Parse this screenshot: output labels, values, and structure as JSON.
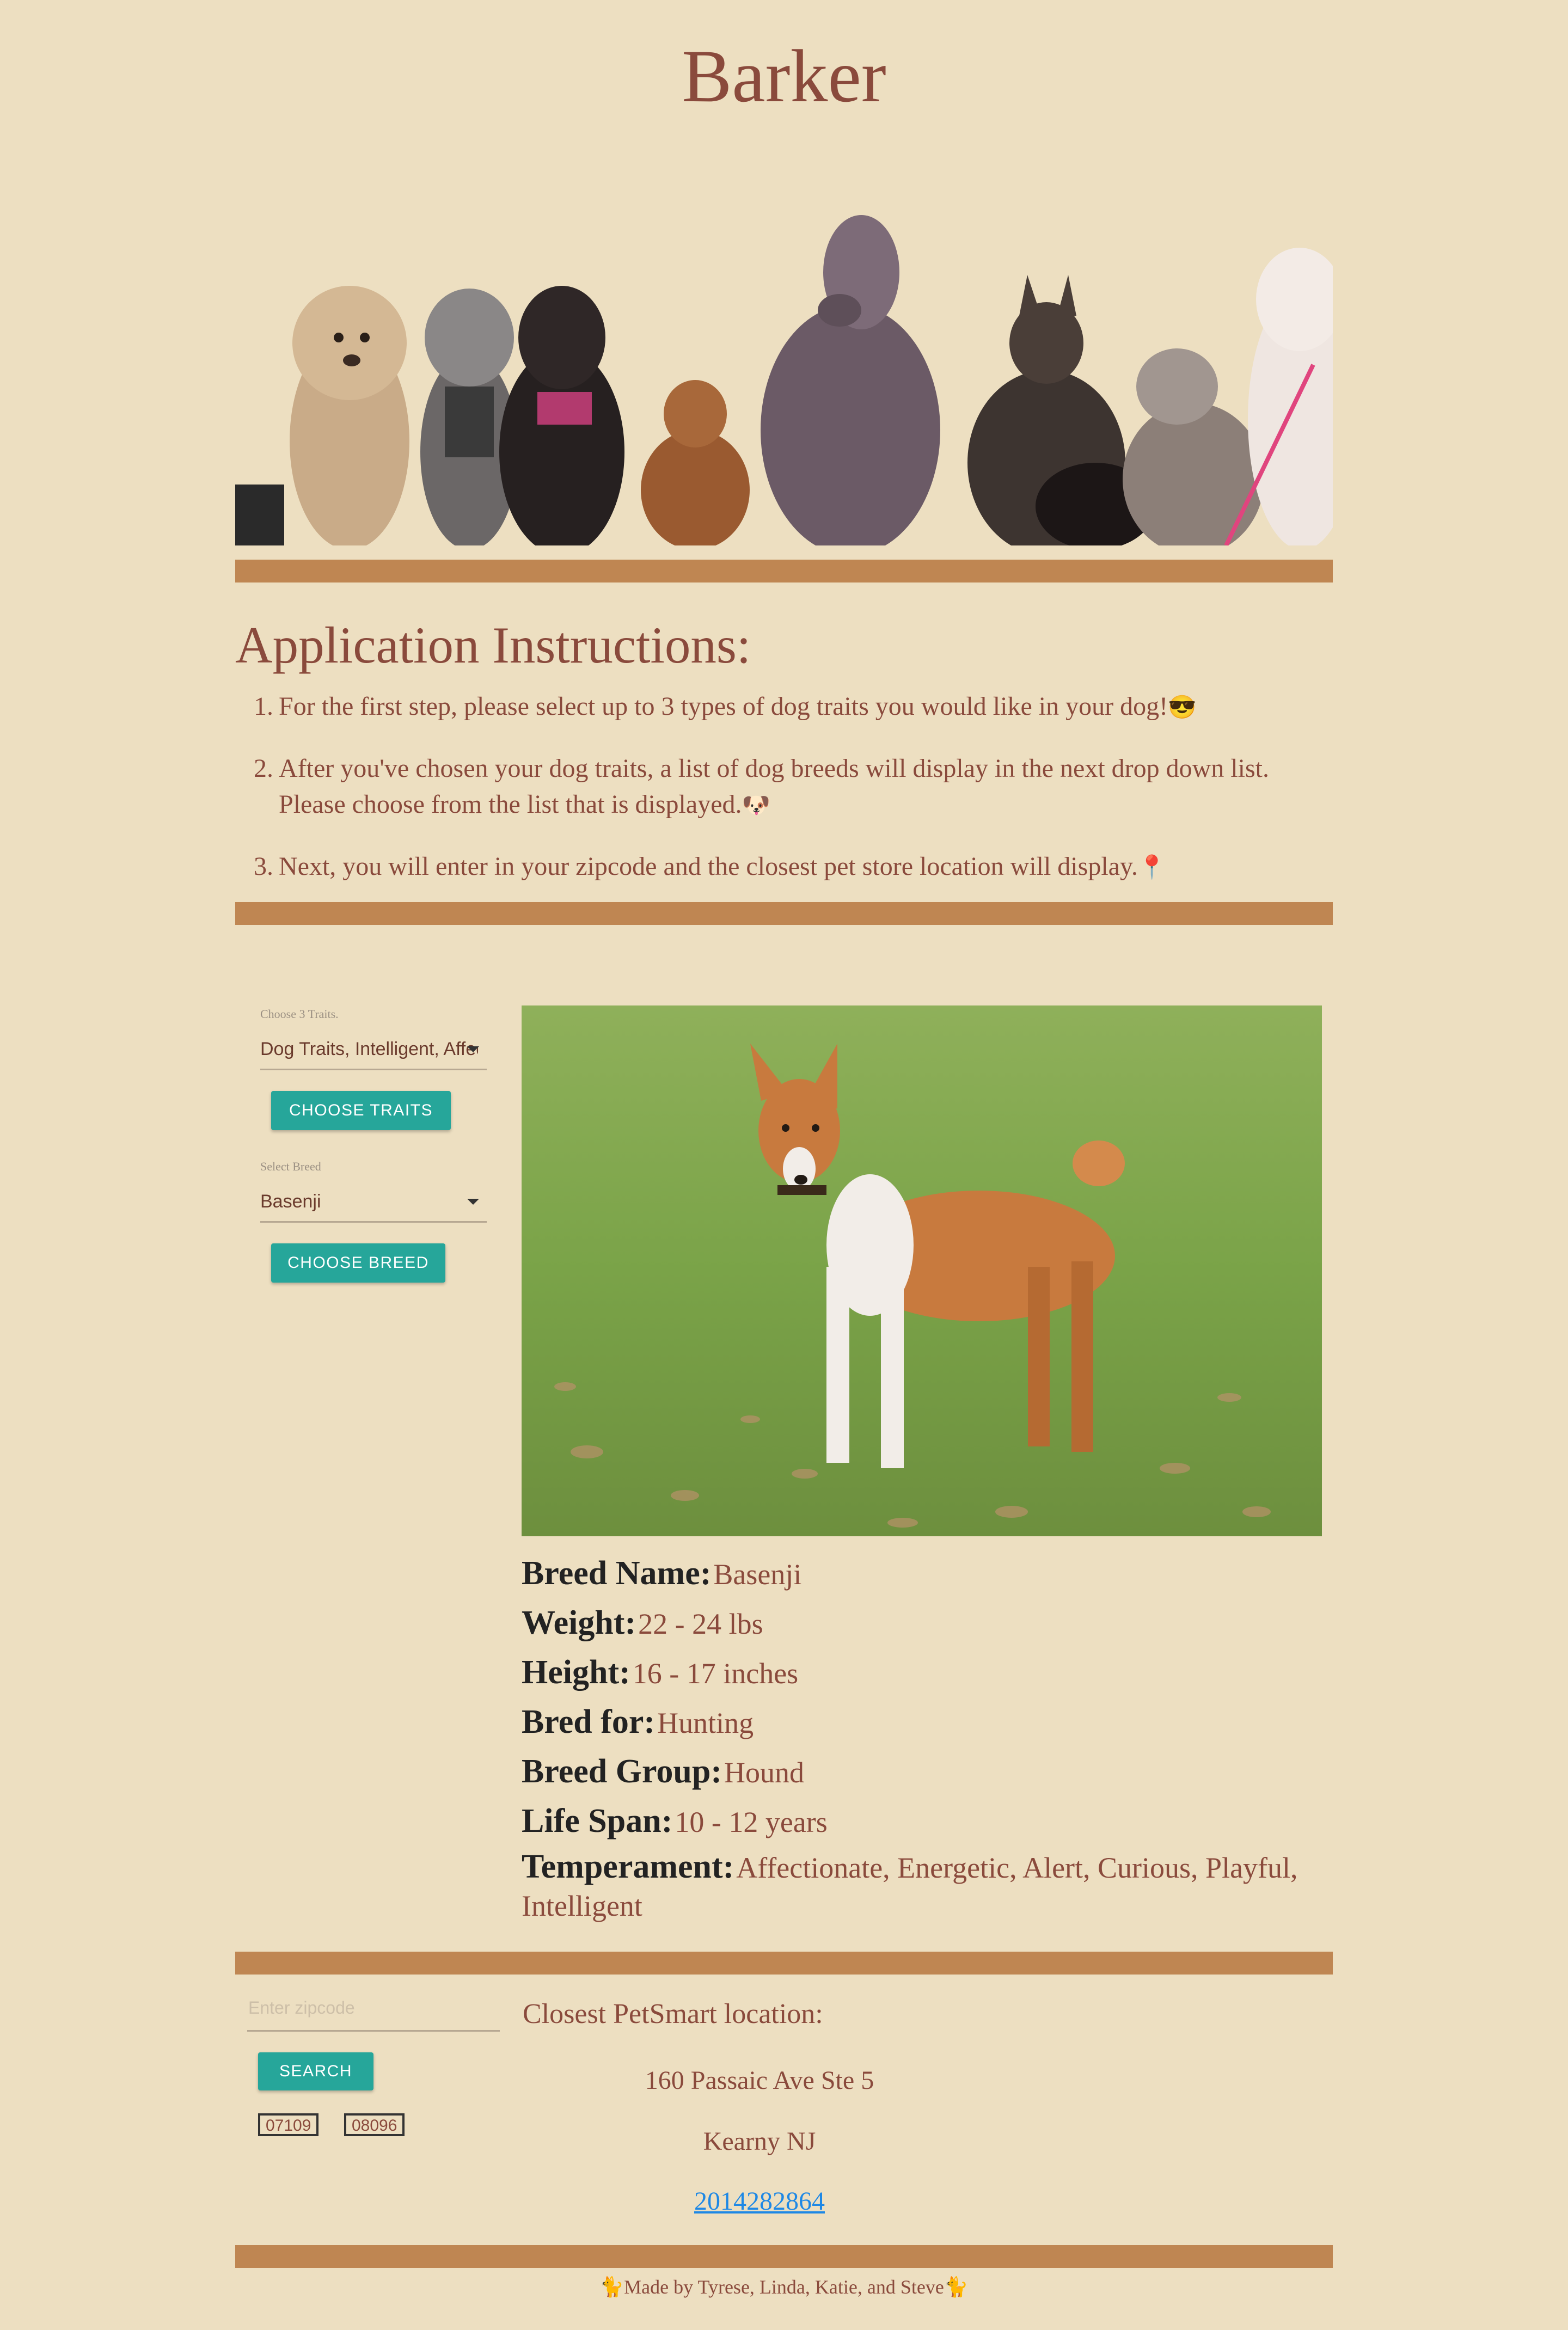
{
  "header": {
    "title": "Barker"
  },
  "instructions": {
    "heading": "Application Instructions:",
    "steps": [
      {
        "num": "1.",
        "text": "For the first step, please select up to 3 types of dog traits you would like in your dog!",
        "emoji": "😎"
      },
      {
        "num": "2.",
        "text": "After you've chosen your dog traits, a list of dog breeds will display in the next drop down list. Please choose from the list that is displayed.",
        "emoji": "🐶"
      },
      {
        "num": "3.",
        "text": "Next, you will enter in your zipcode and the closest pet store location will display.",
        "emoji": "📍"
      }
    ]
  },
  "form": {
    "traits_label": "Choose 3 Traits.",
    "traits_value": "Dog Traits, Intelligent, Affect",
    "choose_traits_button": "CHOOSE TRAITS",
    "breed_label": "Select Breed",
    "breed_value": "Basenji",
    "choose_breed_button": "CHOOSE BREED"
  },
  "breed_info": [
    {
      "key": "Breed Name:",
      "value": "Basenji"
    },
    {
      "key": "Weight:",
      "value": "22 - 24 lbs"
    },
    {
      "key": "Height:",
      "value": "16 - 17 inches"
    },
    {
      "key": "Bred for:",
      "value": "Hunting"
    },
    {
      "key": "Breed Group:",
      "value": "Hound"
    },
    {
      "key": "Life Span:",
      "value": "10 - 12 years"
    },
    {
      "key": "Temperament:",
      "value": "Affectionate, Energetic, Alert, Curious, Playful, Intelligent"
    }
  ],
  "store": {
    "zip_placeholder": "Enter zipcode",
    "search_button": "SEARCH",
    "recent_zips": [
      "07109",
      "08096"
    ],
    "heading": "Closest PetSmart location:",
    "address_line1": "160 Passaic Ave Ste 5",
    "address_line2": "Kearny NJ",
    "phone": "2014282864"
  },
  "footer": {
    "text": "Made by Tyrese, Linda, Katie, and Steve",
    "icon_left": "🐈",
    "icon_right": "🐈"
  },
  "colors": {
    "background": "#eddfc1",
    "divider": "#bf8652",
    "button": "#26a69a",
    "text": "#8a4a3c",
    "link": "#1e88e5"
  }
}
